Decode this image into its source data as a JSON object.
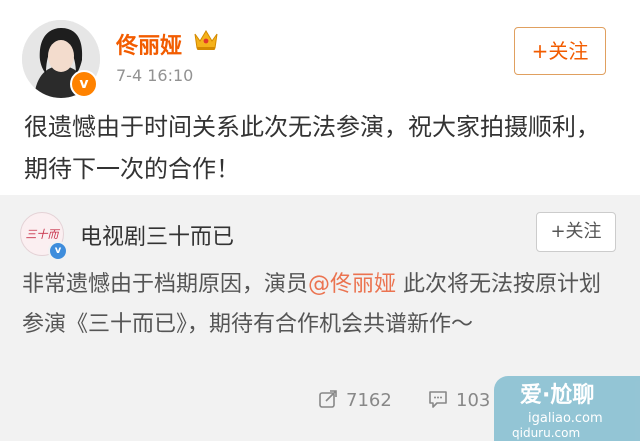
{
  "post": {
    "username": "佟丽娅",
    "timestamp": "7-4 16:10",
    "follow_label": "+关注",
    "text": "很遗憾由于时间关系此次无法参演，祝大家拍摄顺利，期待下一次的合作！",
    "username_color": "#f25c00"
  },
  "repost": {
    "avatar_text": "三十而已",
    "username": "电视剧三十而已",
    "follow_label": "+关注",
    "text_before": "非常遗憾由于档期原因，演员",
    "mention": "@佟丽娅",
    "text_after": " 此次将无法按原计划参演《三十而已》，期待有合作机会共谱新作～",
    "mention_color": "#eb7350"
  },
  "actions": {
    "share_icon": "share-icon",
    "share_count": "7162",
    "comment_icon": "comment-icon",
    "comment_count": "103"
  },
  "watermark": {
    "logo": "爱·尬聊",
    "url": "igaliao.com",
    "url2": "qiduru.com"
  }
}
